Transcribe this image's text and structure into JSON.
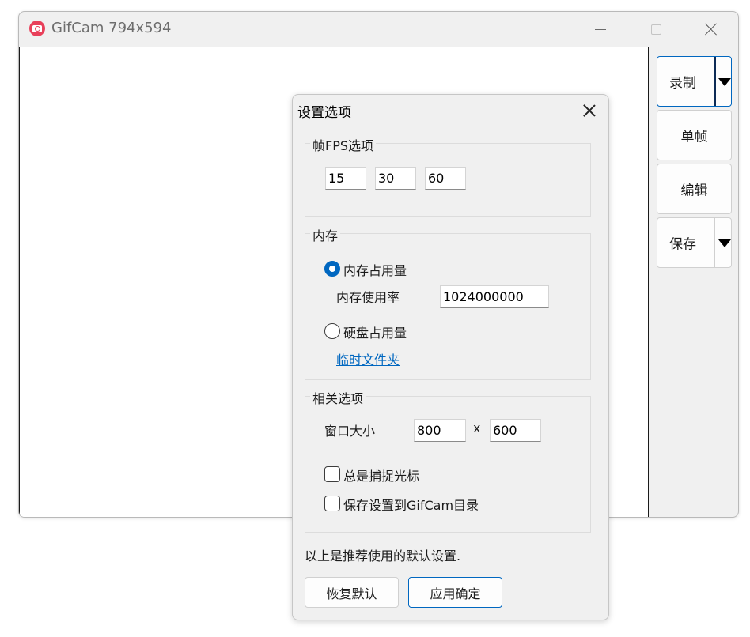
{
  "window": {
    "title": "GifCam 794x594"
  },
  "sidebar": {
    "record_label": "录制",
    "single_frame_label": "单帧",
    "edit_label": "编辑",
    "save_label": "保存"
  },
  "dialog": {
    "title": "设置选项",
    "fps_group": {
      "label": "帧FPS选项",
      "values": [
        "15",
        "30",
        "60"
      ]
    },
    "memory_group": {
      "label": "内存",
      "memory_option": "内存占用量",
      "memory_option_selected": true,
      "usage_label": "内存使用率",
      "usage_value": "1024000000",
      "disk_option": "硬盘占用量",
      "disk_option_selected": false,
      "temp_folder_link": "临时文件夹"
    },
    "options_group": {
      "label": "相关选项",
      "window_size_label": "窗口大小",
      "width": "800",
      "times": "x",
      "height": "600",
      "capture_cursor_label": "总是捕捉光标",
      "capture_cursor_checked": false,
      "save_to_dir_label": "保存设置到GifCam目录",
      "save_to_dir_checked": false
    },
    "note": "以上是推荐使用的默认设置.",
    "restore_label": "恢复默认",
    "apply_label": "应用确定"
  },
  "colors": {
    "accent": "#0067c0",
    "app_icon": "#e8405a",
    "dialog_bg": "#f0f0f0"
  }
}
